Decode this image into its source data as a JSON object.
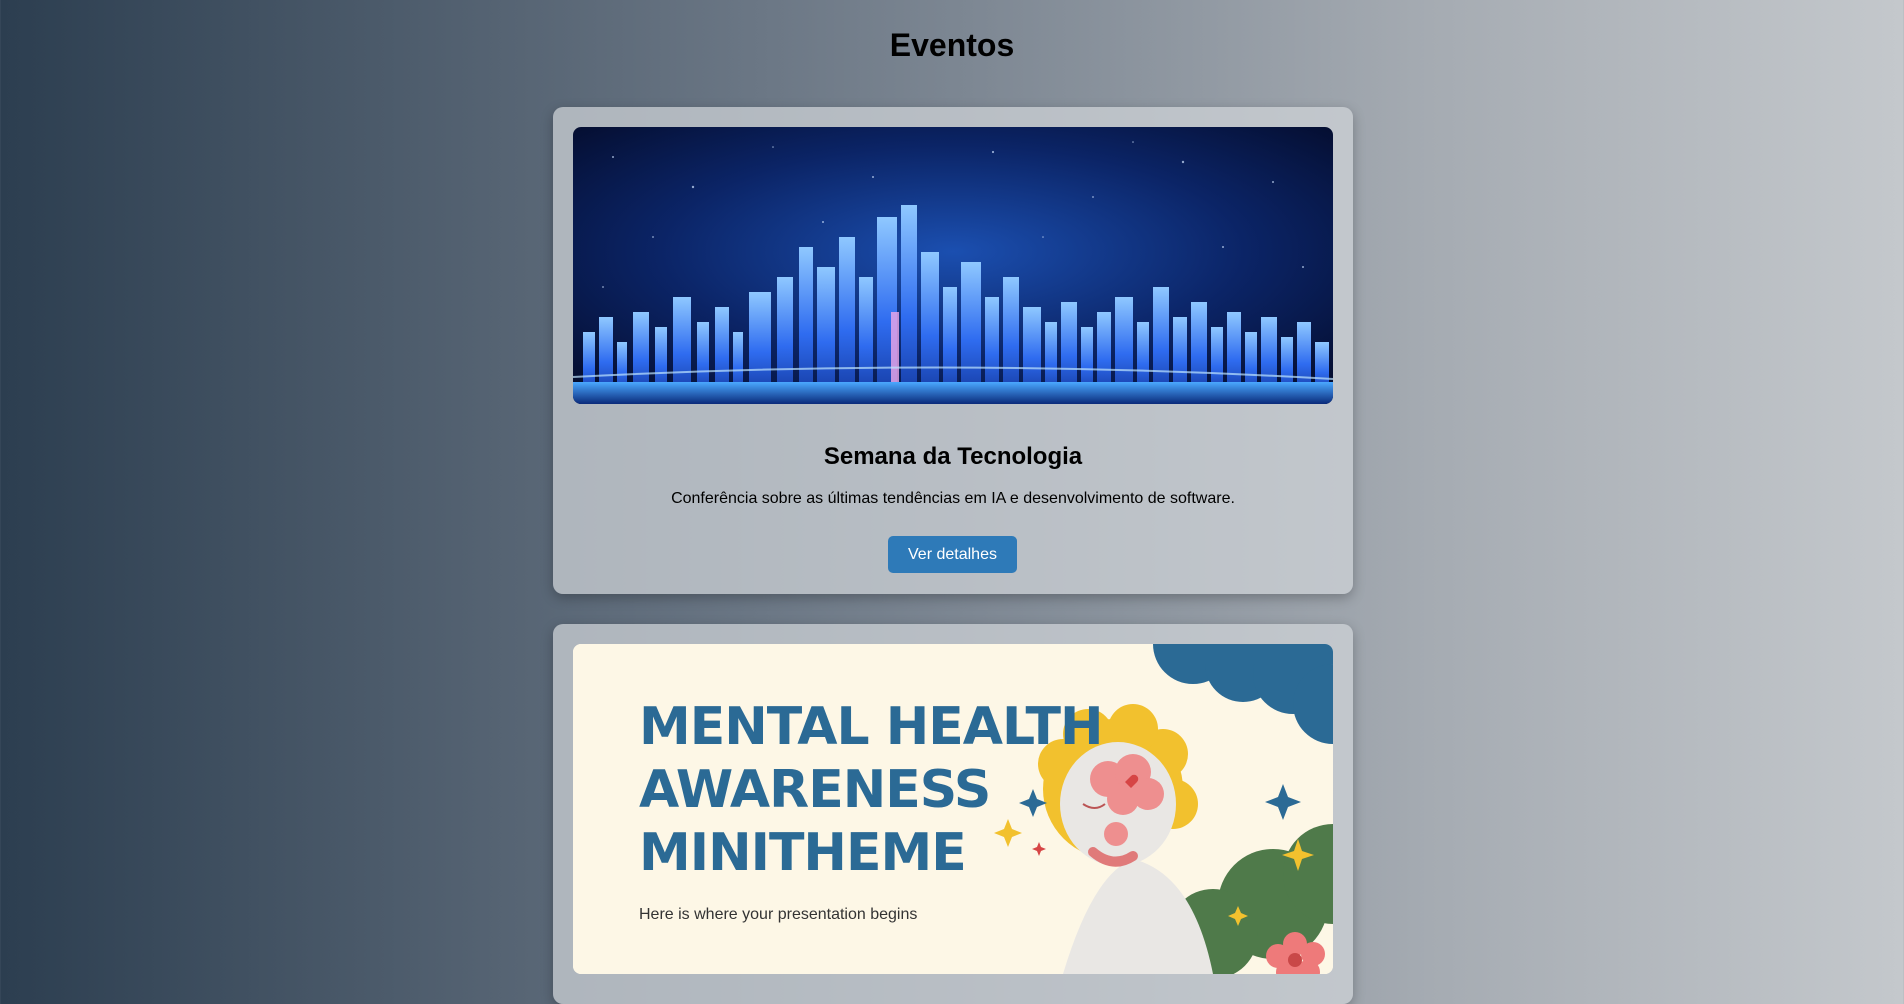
{
  "page": {
    "title": "Eventos"
  },
  "events": [
    {
      "image_name": "tech-city-banner",
      "title": "Semana da Tecnologia",
      "description": "Conferência sobre as últimas tendências em IA e desenvolvimento de software.",
      "button_label": "Ver detalhes"
    },
    {
      "image_name": "mental-health-poster",
      "poster_lines": [
        "MENTAL HEALTH",
        "AWARENESS",
        "MINITHEME"
      ],
      "poster_subtitle": "Here is where your presentation begins"
    }
  ],
  "colors": {
    "button": "#2e7ab8",
    "poster_heading": "#2b6a95",
    "poster_background": "#fdf7e6"
  }
}
